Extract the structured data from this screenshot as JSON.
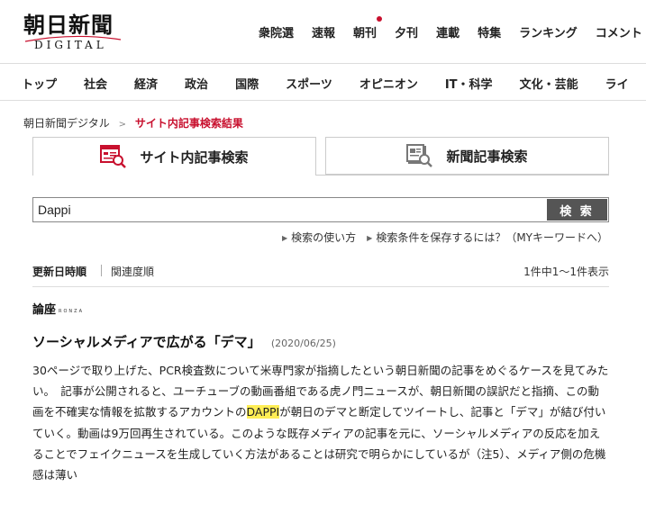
{
  "header": {
    "logo_jp": "朝日新聞",
    "logo_en": "DIGITAL",
    "top_links": [
      "衆院選",
      "速報",
      "朝刊",
      "夕刊",
      "連載",
      "特集",
      "ランキング",
      "コメント"
    ],
    "top_links_dot_index": 2,
    "categories": [
      "トップ",
      "社会",
      "経済",
      "政治",
      "国際",
      "スポーツ",
      "オピニオン",
      "IT・科学",
      "文化・芸能",
      "ライ"
    ]
  },
  "breadcrumb": {
    "home": "朝日新聞デジタル",
    "sep": ">",
    "current": "サイト内記事検索結果"
  },
  "tabs": {
    "site_search": "サイト内記事検索",
    "newspaper_search": "新聞記事検索"
  },
  "search": {
    "query": "Dappi",
    "button": "検 索",
    "help": "検索の使い方",
    "save": "検索条件を保存するには？（MYキーワードへ）"
  },
  "sort": {
    "by_date": "更新日時順",
    "by_relevance": "関連度順",
    "count": "1件中1〜1件表示"
  },
  "result": {
    "source": "論座",
    "source_latin": "RONZA",
    "title": "ソーシャルメディアで広がる「デマ」",
    "date": "(2020/06/25)",
    "snippet_before": "30ページで取り上げた、PCR検査数について米専門家が指摘したという朝日新聞の記事をめぐるケースを見てみたい。　記事が公開されると、ユーチューブの動画番組である虎ノ門ニュースが、朝日新聞の誤訳だと指摘、この動画を不確実な情報を拡散するアカウントの",
    "snippet_highlight": "DAPPI",
    "snippet_after": "が朝日のデマと断定してツイートし、記事と「デマ」が結び付いていく。動画は9万回再生されている。このような既存メディアの記事を元に、ソーシャルメディアの反応を加えることでフェイクニュースを生成していく方法があることは研究で明らかにしているが（注5）、メディア側の危機感は薄い"
  },
  "colors": {
    "accent": "#c8102e",
    "highlight": "#ffee55",
    "button": "#555555"
  }
}
